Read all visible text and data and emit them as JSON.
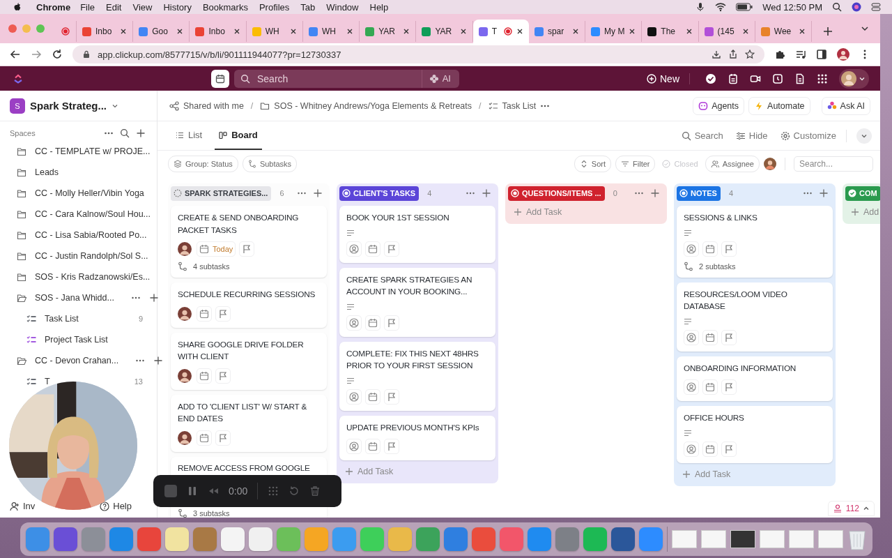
{
  "menubar": {
    "app": "Chrome",
    "menus": [
      "File",
      "Edit",
      "View",
      "History",
      "Bookmarks",
      "Profiles",
      "Tab",
      "Window",
      "Help"
    ],
    "clock": "Wed 12:50 PM"
  },
  "browser": {
    "tabs": [
      {
        "recording": true,
        "selected": false
      },
      {
        "title": "Inbo",
        "recording": false,
        "selected": false,
        "color": "#ea4335"
      },
      {
        "title": "Goo",
        "recording": false,
        "selected": false,
        "color": "#4285f4"
      },
      {
        "title": "Inbo",
        "recording": false,
        "selected": false,
        "color": "#ea4335"
      },
      {
        "title": "WH",
        "recording": false,
        "selected": false,
        "color": "#fbbc04"
      },
      {
        "title": "WH",
        "recording": false,
        "selected": false,
        "color": "#4285f4"
      },
      {
        "title": "YAR",
        "recording": false,
        "selected": false,
        "color": "#34a853"
      },
      {
        "title": "YAR",
        "recording": false,
        "selected": false,
        "color": "#0f9d58"
      },
      {
        "title": "T",
        "recording": true,
        "selected": true,
        "color": "#7b68ee"
      },
      {
        "title": "spar",
        "recording": false,
        "selected": false,
        "color": "#4285f4"
      },
      {
        "title": "My M",
        "recording": false,
        "selected": false,
        "color": "#2d8cff"
      },
      {
        "title": "The",
        "recording": false,
        "selected": false,
        "color": "#111111"
      },
      {
        "title": "(145",
        "recording": false,
        "selected": false,
        "color": "#b14fd8"
      },
      {
        "title": "Wee",
        "recording": false,
        "selected": false,
        "color": "#e8832a"
      }
    ],
    "address": "app.clickup.com/8577715/v/b/li/901111944077?pr=12730337"
  },
  "topbar": {
    "search": {
      "placeholder": "Search"
    },
    "ai": "AI",
    "new": "New"
  },
  "sidebar": {
    "workspace": {
      "initial": "S",
      "name": "Spark Strateg..."
    },
    "section": "Spaces",
    "items": [
      {
        "kind": "folder",
        "label": "CC - TEMPLATE w/ PROJE...",
        "expanded": false
      },
      {
        "kind": "folder",
        "label": "Leads",
        "expanded": false
      },
      {
        "kind": "folder",
        "label": "CC - Molly Heller/Vibin Yoga",
        "expanded": false
      },
      {
        "kind": "folder",
        "label": "CC - Cara Kalnow/Soul Hou...",
        "expanded": false
      },
      {
        "kind": "folder",
        "label": "CC - Lisa Sabia/Rooted Po...",
        "expanded": false
      },
      {
        "kind": "folder",
        "label": "CC - Justin Randolph/Sol S...",
        "expanded": false
      },
      {
        "kind": "folder",
        "label": "SOS - Kris Radzanowski/Es...",
        "expanded": false
      },
      {
        "kind": "folder",
        "label": "SOS - Jana Whidd...",
        "expanded": true,
        "children": [
          {
            "kind": "list",
            "label": "Task List",
            "count": "9",
            "color": "#6b6f76"
          },
          {
            "kind": "list",
            "label": "Project Task List",
            "color": "#a35be0"
          }
        ]
      },
      {
        "kind": "folder",
        "label": "CC - Devon Crahan...",
        "expanded": true,
        "children": [
          {
            "kind": "list",
            "label": "T",
            "count": "13",
            "color": "#6b6f76"
          }
        ]
      }
    ],
    "invite": "Inv",
    "help": "Help"
  },
  "breadcrumb": {
    "items": [
      "Shared with me",
      "SOS - Whitney Andrews/Yoga Elements & Retreats",
      "Task List"
    ],
    "separator": "/"
  },
  "header_buttons": [
    "Agents",
    "Automate",
    "Ask AI"
  ],
  "views": [
    {
      "label": "List",
      "selected": false
    },
    {
      "label": "Board",
      "selected": true
    }
  ],
  "view_actions": [
    "Search",
    "Hide",
    "Customize"
  ],
  "filters": {
    "group": "Group: Status",
    "subtasks": "Subtasks",
    "sort": "Sort",
    "filter": "Filter",
    "closed": {
      "label": "Closed",
      "disabled": true
    },
    "assignee": "Assignee",
    "search": {
      "placeholder": "Search..."
    }
  },
  "columns": [
    {
      "title": "SPARK STRATEGIES...",
      "count": "6",
      "kind": "open",
      "color": "#e6e6ea",
      "cards": [
        {
          "title": "CREATE & SEND ONBOARDING PACKET TASKS",
          "description": false,
          "meta": true,
          "assigned": true,
          "due": "Today",
          "subtasks": "4 subtasks"
        },
        {
          "title": "SCHEDULE RECURRING SESSIONS",
          "description": false,
          "meta": true,
          "assigned": true
        },
        {
          "title": "SHARE GOOGLE DRIVE FOLDER WITH CLIENT",
          "description": false,
          "meta": true,
          "assigned": true
        },
        {
          "title": "ADD TO 'CLIENT LIST' W/ START & END DATES",
          "description": false,
          "meta": true,
          "assigned": true
        },
        {
          "title": "REMOVE ACCESS FROM GOOGLE",
          "meta": false,
          "subtasks": "3 subtasks"
        }
      ]
    },
    {
      "title": "CLIENT'S TASKS",
      "count": "4",
      "kind": "active",
      "color": "#5b45d8",
      "add": "Add Task",
      "cards": [
        {
          "title": "BOOK YOUR 1ST SESSION",
          "description": true,
          "meta": true,
          "assigned": false
        },
        {
          "title": "CREATE SPARK STRATEGIES AN ACCOUNT IN YOUR BOOKING...",
          "description": true,
          "meta": true,
          "assigned": false
        },
        {
          "title": "COMPLETE: FIX THIS NEXT 48HRS PRIOR TO YOUR FIRST SESSION",
          "description": true,
          "meta": true,
          "assigned": false
        },
        {
          "title": "UPDATE PREVIOUS MONTH'S KPIs",
          "description": false,
          "meta": true,
          "assigned": false
        }
      ]
    },
    {
      "title": "QUESTIONS/ITEMS ...",
      "count": "0",
      "kind": "active",
      "color": "#d0222e",
      "add": "Add Task"
    },
    {
      "title": "NOTES",
      "count": "4",
      "kind": "active",
      "color": "#1b74e4",
      "add": "Add Task",
      "cards": [
        {
          "title": "SESSIONS & LINKS",
          "description": true,
          "meta": true,
          "assigned": false,
          "subtasks": "2 subtasks"
        },
        {
          "title": "RESOURCES/LOOM VIDEO DATABASE",
          "description": true,
          "meta": true,
          "assigned": false
        },
        {
          "title": "ONBOARDING INFORMATION",
          "description": false,
          "meta": true,
          "assigned": false
        },
        {
          "title": "OFFICE HOURS",
          "description": true,
          "meta": true,
          "assigned": false
        }
      ]
    },
    {
      "title": "COM",
      "kind": "done",
      "color": "#2a9a4e",
      "add": "Add"
    }
  ],
  "footer_badge": "112",
  "recorder": {
    "time": "0:00"
  },
  "dock": {
    "apps": [
      {
        "color": "#3d8fe6"
      },
      {
        "color": "#6a4fd6"
      },
      {
        "color": "#8c8f98"
      },
      {
        "color": "#1e88e5"
      },
      {
        "color": "#e8453c"
      },
      {
        "color": "#f1e3a0"
      },
      {
        "color": "#a87945"
      },
      {
        "color": "#f4f4f4"
      },
      {
        "color": "#f0f0f0"
      },
      {
        "color": "#6cbf5a"
      },
      {
        "color": "#f5a623"
      },
      {
        "color": "#3b9cf0"
      },
      {
        "color": "#3ecf5a"
      },
      {
        "color": "#e9b949"
      },
      {
        "color": "#3ca35b"
      },
      {
        "color": "#2f7fe0"
      },
      {
        "color": "#ea4d3d"
      },
      {
        "color": "#f2566a"
      },
      {
        "color": "#1f8bf0"
      },
      {
        "color": "#7d8087"
      },
      {
        "color": "#1db954"
      },
      {
        "color": "#2b579a"
      },
      {
        "color": "#2d8cff"
      }
    ]
  }
}
